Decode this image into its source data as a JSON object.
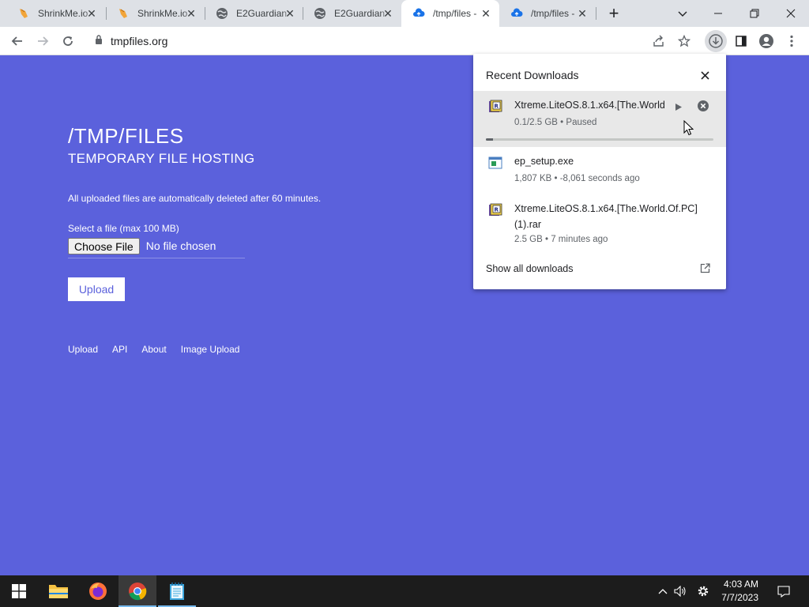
{
  "browser": {
    "tabs": [
      {
        "title": "ShrinkMe.io",
        "icon": "shrinkme-favicon",
        "active": false
      },
      {
        "title": "ShrinkMe.io",
        "icon": "shrinkme-favicon",
        "active": false
      },
      {
        "title": "E2Guardian",
        "icon": "globe-icon",
        "active": false
      },
      {
        "title": "E2Guardian",
        "icon": "globe-icon",
        "active": false
      },
      {
        "title": "/tmp/files -",
        "icon": "cloud-upload-icon",
        "active": true
      },
      {
        "title": "/tmp/files -",
        "icon": "cloud-upload-icon",
        "active": false
      }
    ],
    "close_glyph": "✕",
    "new_tab_glyph": "+",
    "address": "tmpfiles.org"
  },
  "page": {
    "title": "/TMP/FILES",
    "subtitle": "TEMPORARY FILE HOSTING",
    "notice": "All uploaded files are automatically deleted after 60 minutes.",
    "select_label": "Select a file (max 100 MB)",
    "choose_file_label": "Choose File",
    "no_file_label": "No file chosen",
    "upload_label": "Upload",
    "footer_links": [
      "Upload",
      "API",
      "About",
      "Image Upload"
    ],
    "background_color": "#5b61dc"
  },
  "downloads": {
    "header": "Recent Downloads",
    "items": [
      {
        "name": "Xtreme.LiteOS.8.1.x64.[The.World",
        "status": "0.1/2.5 GB • Paused",
        "progress": 0.03,
        "icon": "rar-archive-icon"
      },
      {
        "name": "ep_setup.exe",
        "status": "1,807 KB • -8,061 seconds ago",
        "icon": "exe-file-icon"
      },
      {
        "name_line1": "Xtreme.LiteOS.8.1.x64.[The.World.Of.PC]",
        "name_line2": "(1).rar",
        "status": "2.5 GB • 7 minutes ago",
        "icon": "rar-archive-icon"
      }
    ],
    "show_all": "Show all downloads"
  },
  "taskbar": {
    "time": "4:03 AM",
    "date": "7/7/2023"
  }
}
